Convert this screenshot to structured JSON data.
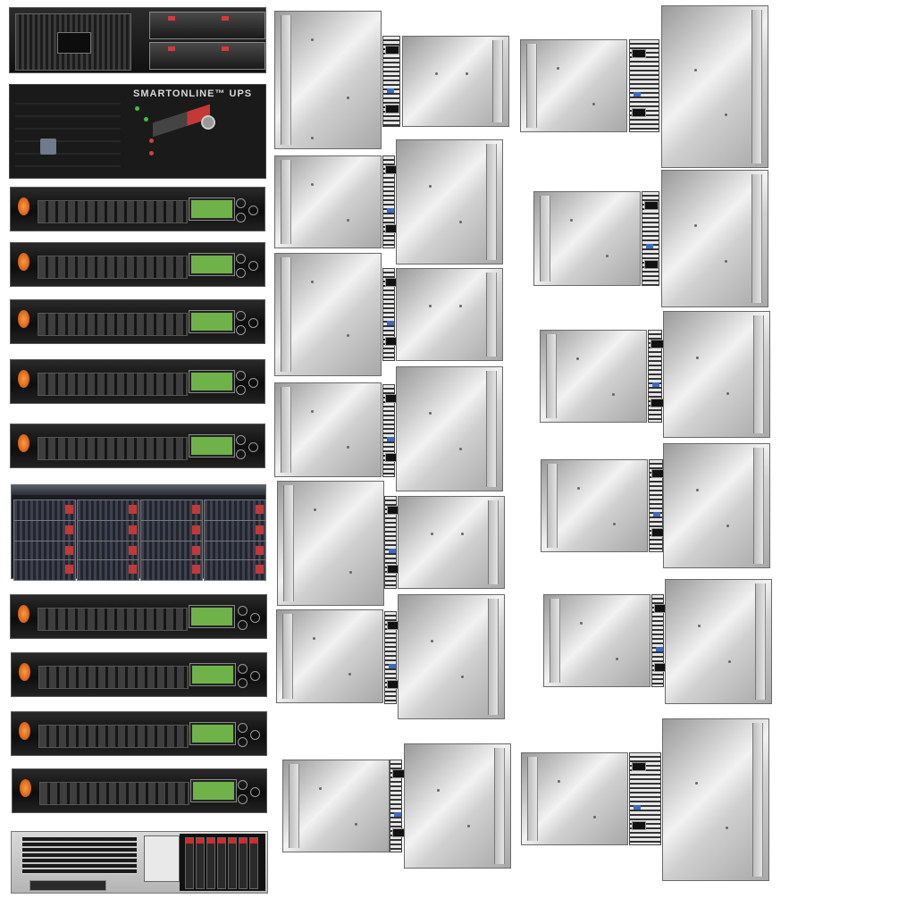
{
  "ups": {
    "brand_text": "SMARTONLINE™ UPS"
  },
  "colors": {
    "background": "#ffffff",
    "switch_power_led": "#e0661c",
    "switch_lcd": "#6fb24a",
    "storage_tray_tab": "#c33838",
    "chassis_metal": "#c9c9c9"
  },
  "icons": {
    "ups_logo": "tripp-lite-logo-icon",
    "switch_power": "power-button-icon"
  }
}
